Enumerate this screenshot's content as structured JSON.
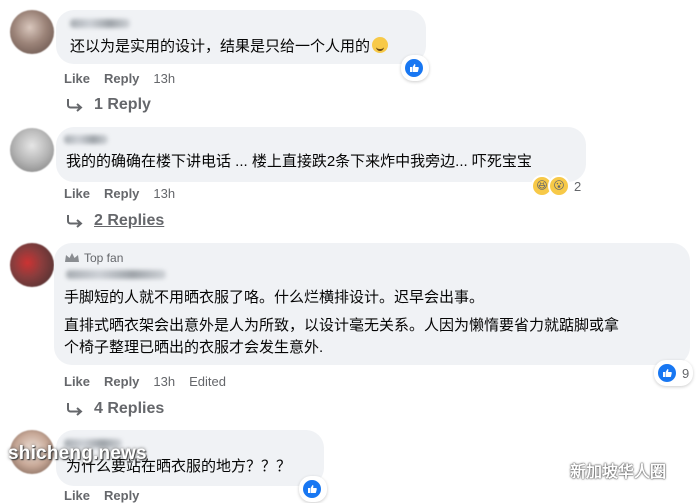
{
  "comments": [
    {
      "text": "还以为是实用的设计，结果是只给一个人用的",
      "actions": {
        "like": "Like",
        "reply": "Reply",
        "time": "13h"
      },
      "replies": "1 Reply",
      "reaction_count": ""
    },
    {
      "text": "我的的确确在楼下讲电话 ... 楼上直接跌2条下来炸中我旁边... 吓死宝宝",
      "actions": {
        "like": "Like",
        "reply": "Reply",
        "time": "13h"
      },
      "replies": "2 Replies",
      "reaction_count": "2"
    },
    {
      "badge": "Top fan",
      "text1": "手脚短的人就不用晒衣服了咯。什么烂横排设计。迟早会出事。",
      "text2": "直排式晒衣架会出意外是人为所致，以设计毫无关系。人因为懒惰要省力就踮脚或拿",
      "text3": "个椅子整理已晒出的衣服才会发生意外.",
      "actions": {
        "like": "Like",
        "reply": "Reply",
        "time": "13h",
        "edited": "Edited"
      },
      "replies": "4 Replies",
      "reaction_count": "9"
    },
    {
      "text": "为什么要站在晒衣服的地方？？？",
      "actions": {
        "like": "Like",
        "reply": "Reply"
      }
    }
  ],
  "watermark": "shicheng.news",
  "wechat_label": "新加坡华人圈",
  "colors": {
    "bubble": "#f0f2f5",
    "like_blue": "#1877f2",
    "meta_gray": "#65676b"
  }
}
